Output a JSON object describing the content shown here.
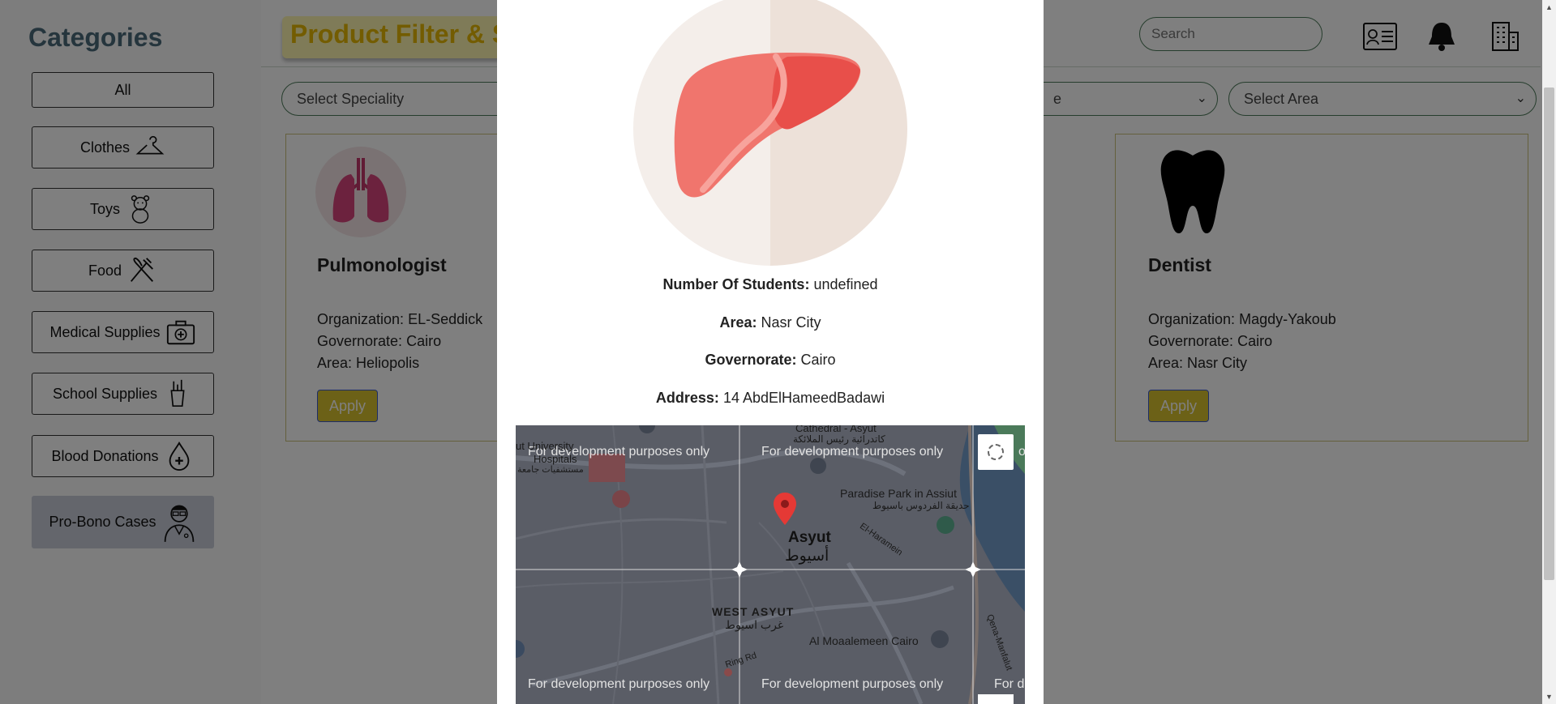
{
  "sidebar": {
    "title": "Categories",
    "items": [
      {
        "label": "All",
        "icon": ""
      },
      {
        "label": "Clothes",
        "icon": "hanger-icon"
      },
      {
        "label": "Toys",
        "icon": "teddy-bear-icon"
      },
      {
        "label": "Food",
        "icon": "fork-knife-icon"
      },
      {
        "label": "Medical Supplies",
        "icon": "medical-kit-icon"
      },
      {
        "label": "School Supplies",
        "icon": "pencil-cup-icon"
      },
      {
        "label": "Blood Donations",
        "icon": "blood-drop-icon"
      },
      {
        "label": "Pro-Bono Cases",
        "icon": "doctor-icon"
      }
    ]
  },
  "header": {
    "title": "Product Filter & S",
    "search_placeholder": "Search",
    "icons": [
      "id-card-icon",
      "bell-icon",
      "building-icon"
    ]
  },
  "filters": {
    "speciality_placeholder": "Select Speciality",
    "governorate_partial": "e",
    "area_placeholder": "Select Area"
  },
  "cards": [
    {
      "icon": "lungs-icon",
      "title": "Pulmonologist",
      "organization_label": "Organization:",
      "organization": "EL-Seddick",
      "governorate_label": "Governorate:",
      "governorate": "Cairo",
      "area_label": "Area:",
      "area": "Heliopolis",
      "button": "Apply"
    },
    {
      "icon": "tooth-icon",
      "title": "Dentist",
      "organization_label": "Organization:",
      "organization": "Magdy-Yakoub",
      "governorate_label": "Governorate:",
      "governorate": "Cairo",
      "area_label": "Area:",
      "area": "Nasr City",
      "button": "Apply"
    }
  ],
  "modal": {
    "icon": "liver-icon",
    "fields": [
      {
        "label": "Number Of Students:",
        "value": "undefined"
      },
      {
        "label": "Area:",
        "value": "Nasr City"
      },
      {
        "label": "Governorate:",
        "value": "Cairo"
      },
      {
        "label": "Address:",
        "value": "14 AbdElHameedBadawi"
      }
    ],
    "map": {
      "watermark": "For development purposes only",
      "watermark_partial": "o",
      "watermark_partial2": "For d",
      "labels": {
        "city_en": "Asyut",
        "city_ar": "أسيوط",
        "west_en": "WEST ASYUT",
        "west_ar": "غرب اسيوط",
        "park_en": "Paradise Park in Assiut",
        "park_ar": "حديقة الفردوس باسيوط",
        "university": "ut University",
        "hospitals": "Hospitals",
        "hospitals_ar": "مستشفيات جامعة",
        "cathedral": "Cathedral - Asyut",
        "cathedral_ar": "كاتدرائية رئيس الملائكة",
        "road1": "El-Haramein",
        "road2": "Qena-Manfalut",
        "road3": "Ring Rd",
        "cairo_place": "Al Moaalemeen Cairo"
      }
    }
  },
  "colors": {
    "accent_yellow": "#d9c22e",
    "title_yellow": "#e6b800",
    "border_green": "#4d7a5a",
    "overlay": "rgba(0,0,0,0.5)"
  }
}
